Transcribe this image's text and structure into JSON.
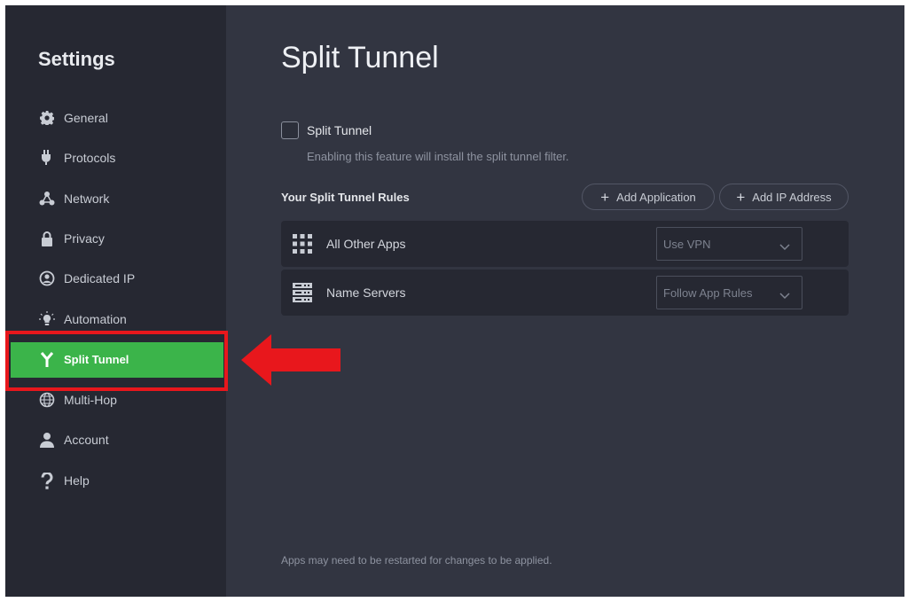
{
  "sidebar": {
    "title": "Settings",
    "items": [
      {
        "label": "General",
        "icon": "gear-icon"
      },
      {
        "label": "Protocols",
        "icon": "plug-icon"
      },
      {
        "label": "Network",
        "icon": "network-icon"
      },
      {
        "label": "Privacy",
        "icon": "lock-icon"
      },
      {
        "label": "Dedicated IP",
        "icon": "dedicated-ip-icon"
      },
      {
        "label": "Automation",
        "icon": "lightbulb-icon"
      },
      {
        "label": "Split Tunnel",
        "icon": "split-icon",
        "active": true
      },
      {
        "label": "Multi-Hop",
        "icon": "globe-icon"
      },
      {
        "label": "Account",
        "icon": "user-icon"
      },
      {
        "label": "Help",
        "icon": "question-icon"
      }
    ]
  },
  "main": {
    "title": "Split Tunnel",
    "toggle": {
      "label": "Split Tunnel",
      "checked": false,
      "description": "Enabling this feature will install the split tunnel filter."
    },
    "rules_heading": "Your Split Tunnel Rules",
    "add_application": "Add Application",
    "add_ip_address": "Add IP Address",
    "rules": [
      {
        "name": "All Other Apps",
        "icon": "grid-icon",
        "value": "Use VPN"
      },
      {
        "name": "Name Servers",
        "icon": "server-icon",
        "value": "Follow App Rules"
      }
    ],
    "footer_note": "Apps may need to be restarted for changes to be applied."
  },
  "colors": {
    "active": "#3bb44a",
    "annotation": "#e8171c",
    "sidebar_bg": "#262832",
    "main_bg": "#323541"
  }
}
